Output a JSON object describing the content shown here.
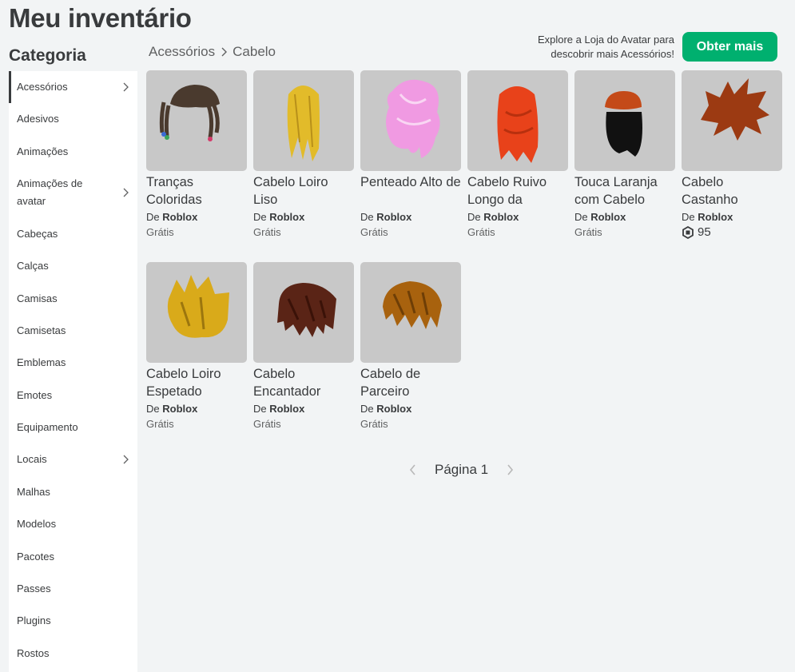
{
  "page": {
    "title": "Meu inventário"
  },
  "sidebar": {
    "heading": "Categoria",
    "items": [
      {
        "label": "Acessórios",
        "has_submenu": true,
        "active": true
      },
      {
        "label": "Adesivos"
      },
      {
        "label": "Animações"
      },
      {
        "label": "Animações de avatar",
        "has_submenu": true
      },
      {
        "label": "Cabeças"
      },
      {
        "label": "Calças"
      },
      {
        "label": "Camisas"
      },
      {
        "label": "Camisetas"
      },
      {
        "label": "Emblemas"
      },
      {
        "label": "Emotes"
      },
      {
        "label": "Equipamento"
      },
      {
        "label": "Locais",
        "has_submenu": true
      },
      {
        "label": "Malhas"
      },
      {
        "label": "Modelos"
      },
      {
        "label": "Pacotes"
      },
      {
        "label": "Passes"
      },
      {
        "label": "Plugins"
      },
      {
        "label": "Rostos"
      }
    ]
  },
  "breadcrumb": {
    "parent": "Acessórios",
    "current": "Cabelo"
  },
  "promo": {
    "text": "Explore a Loja do Avatar para descobrir mais Acessórios!",
    "button_label": "Obter mais"
  },
  "items": [
    {
      "name": "Tranças Coloridas",
      "creator_prefix": "De",
      "creator": "Roblox",
      "price": "Grátis",
      "color": "#4a3a2e"
    },
    {
      "name": "Cabelo Loiro Liso",
      "creator_prefix": "De",
      "creator": "Roblox",
      "price": "Grátis",
      "color": "#e2bb2a"
    },
    {
      "name": "Penteado Alto de",
      "creator_prefix": "De",
      "creator": "Roblox",
      "price": "Grátis",
      "color": "#f09ae2"
    },
    {
      "name": "Cabelo Ruivo Longo da",
      "creator_prefix": "De",
      "creator": "Roblox",
      "price": "Grátis",
      "color": "#e8421a"
    },
    {
      "name": "Touca Laranja com Cabelo",
      "creator_prefix": "De",
      "creator": "Roblox",
      "price": "Grátis",
      "color": "#c44a18"
    },
    {
      "name": "Cabelo Castanho",
      "creator_prefix": "De",
      "creator": "Roblox",
      "price": "95",
      "price_is_robux": true,
      "color": "#9c3a12"
    },
    {
      "name": "Cabelo Loiro Espetado",
      "creator_prefix": "De",
      "creator": "Roblox",
      "price": "Grátis",
      "color": "#d9aa1a"
    },
    {
      "name": "Cabelo Encantador",
      "creator_prefix": "De",
      "creator": "Roblox",
      "price": "Grátis",
      "color": "#5a2416"
    },
    {
      "name": "Cabelo de Parceiro",
      "creator_prefix": "De",
      "creator": "Roblox",
      "price": "Grátis",
      "color": "#a8620e"
    }
  ],
  "pagination": {
    "label": "Página 1"
  },
  "colors": {
    "accent_green": "#00b06f",
    "thumb_bg": "#c8c8c8",
    "page_bg": "#f2f4f5"
  }
}
